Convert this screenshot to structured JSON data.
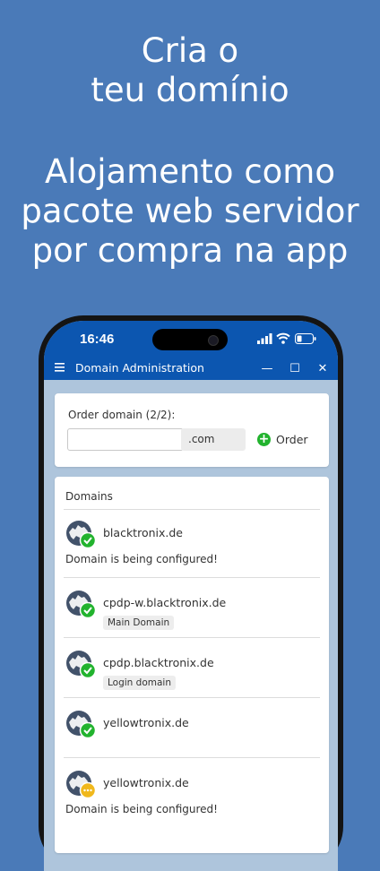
{
  "headline": {
    "line1": "Cria o",
    "line2": "teu domínio",
    "line3": "Alojamento como",
    "line4": "pacote web servidor",
    "line5": "por compra na app"
  },
  "status_bar": {
    "time": "16:46"
  },
  "window": {
    "title": "Domain Administration",
    "minimize": "—",
    "maximize": "☐",
    "close": "✕"
  },
  "order": {
    "label": "Order domain (2/2):",
    "input_value": "",
    "tld": ".com",
    "button_label": "Order"
  },
  "domains": {
    "header": "Domains",
    "items": [
      {
        "name": "blacktronix.de",
        "badge": "",
        "status": "Domain is being configured!",
        "state": "ok"
      },
      {
        "name": "cpdp-w.blacktronix.de",
        "badge": "Main Domain",
        "status": "",
        "state": "ok"
      },
      {
        "name": "cpdp.blacktronix.de",
        "badge": "Login domain",
        "status": "",
        "state": "ok"
      },
      {
        "name": "yellowtronix.de",
        "badge": "",
        "status": "",
        "state": "ok"
      },
      {
        "name": "yellowtronix.de",
        "badge": "",
        "status": "Domain is being configured!",
        "state": "pending"
      }
    ]
  },
  "colors": {
    "background": "#4a7ab8",
    "app_bar": "#0c56b0",
    "ok_badge": "#22b32e",
    "pending_badge": "#f0b81c"
  }
}
